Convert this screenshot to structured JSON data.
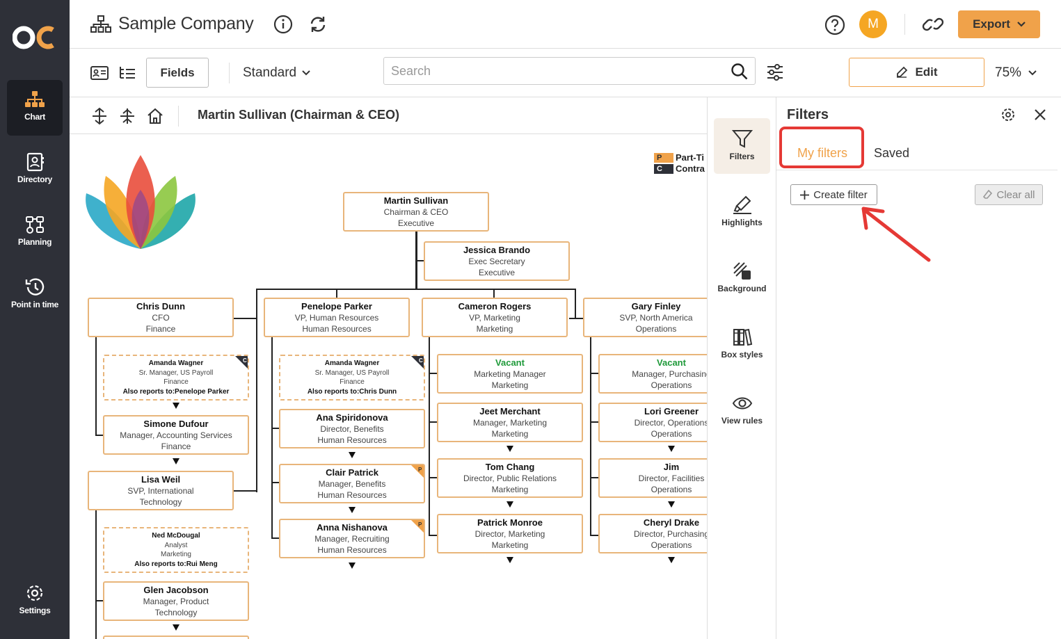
{
  "nav": {
    "items": [
      {
        "label": "Chart"
      },
      {
        "label": "Directory"
      },
      {
        "label": "Planning"
      },
      {
        "label": "Point in time"
      },
      {
        "label": "Settings"
      }
    ]
  },
  "header": {
    "company": "Sample Company",
    "avatar_initial": "M",
    "export_label": "Export"
  },
  "toolbar": {
    "fields_label": "Fields",
    "layout_label": "Standard",
    "search_placeholder": "Search",
    "edit_label": "Edit",
    "zoom": "75%"
  },
  "breadcrumb": {
    "path": "Martin Sullivan (Chairman & CEO)"
  },
  "legend": [
    {
      "code": "P",
      "label": "Part-Ti",
      "color": "#f0a24a"
    },
    {
      "code": "C",
      "label": "Contra",
      "color": "#2e3038"
    }
  ],
  "chart": {
    "root": {
      "name": "Martin Sullivan",
      "title": "Chairman & CEO",
      "dept": "Executive"
    },
    "assistant": {
      "name": "Jessica Brando",
      "title": "Exec Secretary",
      "dept": "Executive"
    },
    "col1": [
      {
        "name": "Chris  Dunn",
        "title": "CFO",
        "dept": "Finance"
      },
      {
        "name": "Amanda Wagner",
        "title": "Sr. Manager, US Payroll",
        "dept": "Finance",
        "also": "Also reports to:Penelope Parker"
      },
      {
        "name": "Simone Dufour",
        "title": "Manager, Accounting Services",
        "dept": "Finance"
      },
      {
        "name": "Lisa Weil",
        "title": "SVP, International",
        "dept": "Technology"
      },
      {
        "name": "Ned McDougal",
        "title": "Analyst",
        "dept": "Marketing",
        "also": "Also reports to:Rui Meng"
      },
      {
        "name": "Glen Jacobson",
        "title": "Manager, Product",
        "dept": "Technology"
      }
    ],
    "col2": [
      {
        "name": "Penelope Parker",
        "title": "VP, Human Resources",
        "dept": "Human Resources"
      },
      {
        "name": "Amanda Wagner",
        "title": "Sr. Manager, US Payroll",
        "dept": "Finance",
        "also": "Also reports to:Chris  Dunn"
      },
      {
        "name": "Ana Spiridonova",
        "title": "Director, Benefits",
        "dept": "Human Resources"
      },
      {
        "name": "Clair Patrick",
        "title": "Manager, Benefits",
        "dept": "Human Resources"
      },
      {
        "name": "Anna Nishanova",
        "title": "Manager, Recruiting",
        "dept": "Human Resources"
      }
    ],
    "col3": [
      {
        "name": "Cameron Rogers",
        "title": "VP, Marketing",
        "dept": "Marketing"
      },
      {
        "name": "Vacant",
        "title": "Marketing Manager",
        "dept": "Marketing"
      },
      {
        "name": "Jeet Merchant",
        "title": "Manager, Marketing",
        "dept": "Marketing"
      },
      {
        "name": "Tom Chang",
        "title": "Director, Public Relations",
        "dept": "Marketing"
      },
      {
        "name": "Patrick Monroe",
        "title": "Director, Marketing",
        "dept": "Marketing"
      }
    ],
    "col4": [
      {
        "name": "Gary Finley",
        "title": "SVP, North America",
        "dept": "Operations"
      },
      {
        "name": "Vacant",
        "title": "Manager, Purchasing",
        "dept": "Operations"
      },
      {
        "name": "Lori Greener",
        "title": "Director, Operations",
        "dept": "Operations"
      },
      {
        "name": "Jim",
        "title": "Director, Facilities",
        "dept": "Operations"
      },
      {
        "name": "Cheryl Drake",
        "title": "Director, Purchasing",
        "dept": "Operations"
      }
    ],
    "badges": {
      "part_time": "P",
      "contract": "C"
    }
  },
  "rail": {
    "items": [
      {
        "label": "Filters"
      },
      {
        "label": "Highlights"
      },
      {
        "label": "Background"
      },
      {
        "label": "Box styles"
      },
      {
        "label": "View rules"
      }
    ]
  },
  "filters": {
    "title": "Filters",
    "tabs": [
      "My filters",
      "Saved"
    ],
    "create_label": "Create filter",
    "clear_label": "Clear all"
  },
  "colors": {
    "accent": "#f0a24a",
    "nav_bg": "#2e3038",
    "highlight": "#e53935",
    "vacant": "#1f9a3a"
  }
}
